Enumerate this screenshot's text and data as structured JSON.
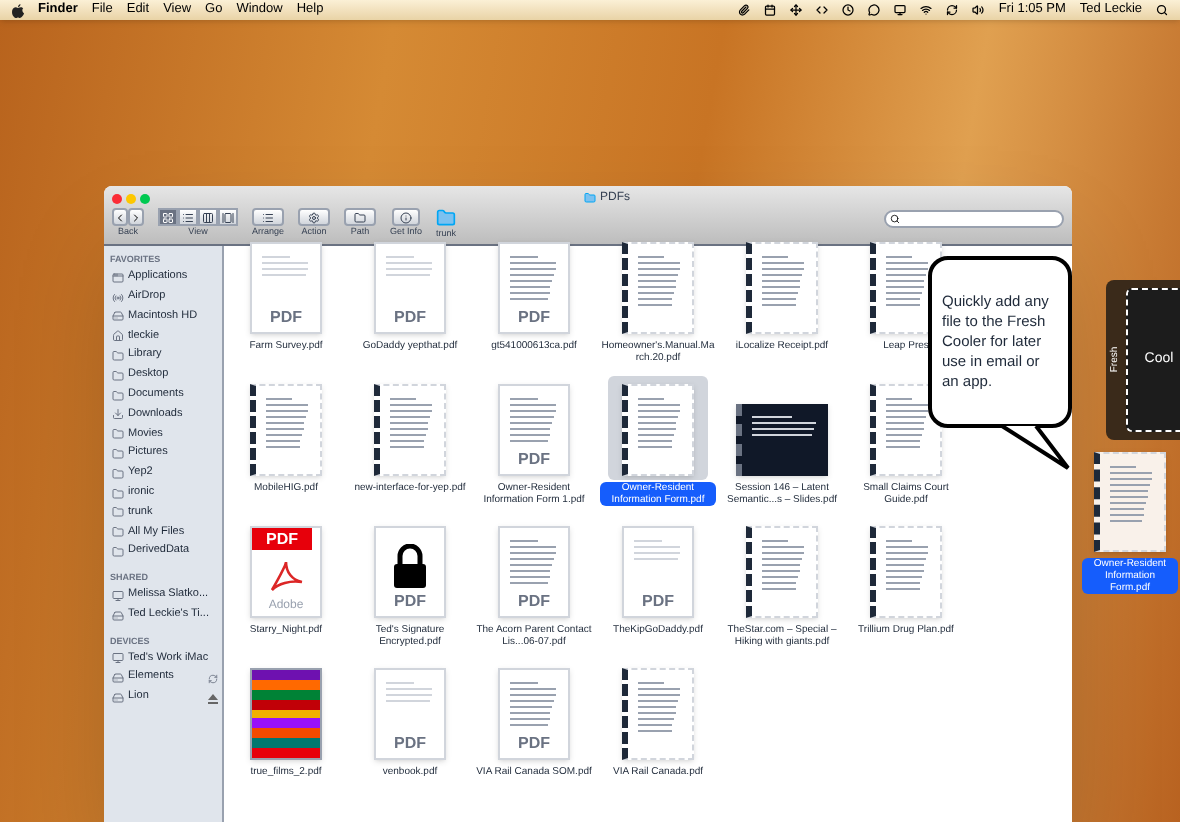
{
  "menu_bar": {
    "app": "Finder",
    "menus": [
      "File",
      "Edit",
      "View",
      "Go",
      "Window",
      "Help"
    ],
    "clock": "Fri 1:05 PM",
    "user": "Ted Leckie"
  },
  "window": {
    "title": "PDFs",
    "toolbar": {
      "labels": [
        "Back",
        "View",
        "Arrange",
        "Action",
        "Path",
        "Get Info",
        "trunk"
      ],
      "view_modes": [
        {
          "selected": true
        },
        {
          "selected": false
        },
        {
          "selected": false
        },
        {
          "selected": false
        }
      ]
    },
    "sidebar": [
      {
        "heading": "FAVORITES",
        "items": [
          {
            "label": "Applications",
            "kind": "apps"
          },
          {
            "label": "AirDrop",
            "kind": "airdrop"
          },
          {
            "label": "Macintosh HD",
            "kind": "disk"
          },
          {
            "label": "tleckie",
            "kind": "home"
          },
          {
            "label": "Library",
            "kind": "folder"
          },
          {
            "label": "Desktop",
            "kind": "folder"
          },
          {
            "label": "Documents",
            "kind": "folder"
          },
          {
            "label": "Downloads",
            "kind": "download"
          },
          {
            "label": "Movies",
            "kind": "folder"
          },
          {
            "label": "Pictures",
            "kind": "folder"
          },
          {
            "label": "Yep2",
            "kind": "folder"
          },
          {
            "label": "ironic",
            "kind": "folder"
          },
          {
            "label": "trunk",
            "kind": "folder"
          },
          {
            "label": "All My Files",
            "kind": "folder"
          },
          {
            "label": "DerivedData",
            "kind": "folder"
          }
        ]
      },
      {
        "heading": "SHARED",
        "items": [
          {
            "label": "Melissa Slatko...",
            "kind": "computer"
          },
          {
            "label": "Ted Leckie's Ti...",
            "kind": "drive"
          }
        ]
      },
      {
        "heading": "DEVICES",
        "items": [
          {
            "label": "Ted's Work iMac",
            "kind": "computer",
            "syncing": false,
            "ejectable": false
          },
          {
            "label": "Elements",
            "kind": "drive",
            "syncing": true,
            "ejectable": false
          },
          {
            "label": "Lion",
            "kind": "drive",
            "syncing": false,
            "ejectable": true
          }
        ]
      }
    ],
    "files": [
      {
        "name": "Farm Survey.pdf",
        "kind": "plain",
        "badge": "PDF",
        "selected": false
      },
      {
        "name": "GoDaddy yepthat.pdf",
        "kind": "plain",
        "badge": "PDF",
        "selected": false
      },
      {
        "name": "gt541000613ca.pdf",
        "kind": "doc",
        "badge": "PDF",
        "selected": false
      },
      {
        "name": "Homeowner's.Manual.March.20.pdf",
        "kind": "spiral",
        "selected": false
      },
      {
        "name": "iLocalize Receipt.pdf",
        "kind": "spiral",
        "selected": false
      },
      {
        "name": "Leap Pres",
        "kind": "spiral",
        "selected": false
      },
      {
        "name": "MobileHIG.pdf",
        "kind": "spiral",
        "selected": false
      },
      {
        "name": "new-interface-for-yep.pdf",
        "kind": "spiral",
        "selected": false
      },
      {
        "name": "Owner-Resident Information Form 1.pdf",
        "kind": "doc",
        "badge": "PDF",
        "selected": false
      },
      {
        "name": "Owner-Resident Information Form.pdf",
        "kind": "spiral",
        "selected": true
      },
      {
        "name": "Session 146 – Latent Semantic...s – Slides.pdf",
        "kind": "dark",
        "selected": false
      },
      {
        "name": "Small Claims Court Guide.pdf",
        "kind": "spiral",
        "selected": false
      },
      {
        "name": "Starry_Night.pdf",
        "kind": "adobe",
        "badge": "PDF",
        "brand": "Adobe",
        "selected": false
      },
      {
        "name": "Ted's Signature Encrypted.pdf",
        "kind": "lock",
        "badge": "PDF",
        "selected": false
      },
      {
        "name": "The Acorn Parent Contact Lis...06-07.pdf",
        "kind": "doc",
        "badge": "PDF",
        "selected": false
      },
      {
        "name": "TheKipGoDaddy.pdf",
        "kind": "plain",
        "badge": "PDF",
        "selected": false
      },
      {
        "name": "TheStar.com – Special – Hiking with giants.pdf",
        "kind": "spiral",
        "selected": false
      },
      {
        "name": "Trillium Drug Plan.pdf",
        "kind": "spiral",
        "selected": false
      },
      {
        "name": "true_films_2.pdf",
        "kind": "striped",
        "selected": false
      },
      {
        "name": "venbook.pdf",
        "kind": "plain",
        "badge": "PDF",
        "selected": false
      },
      {
        "name": "VIA Rail Canada SOM.pdf",
        "kind": "doc",
        "badge": "PDF",
        "selected": false
      },
      {
        "name": "VIA Rail Canada.pdf",
        "kind": "spiral",
        "selected": false
      }
    ]
  },
  "callout": "Quickly add any file to the Fresh Cooler for later use in email or an app.",
  "cooler": {
    "side_label": "Fresh",
    "column_label": "Cool",
    "dragged_file": "Owner-Resident Information Form.pdf"
  }
}
